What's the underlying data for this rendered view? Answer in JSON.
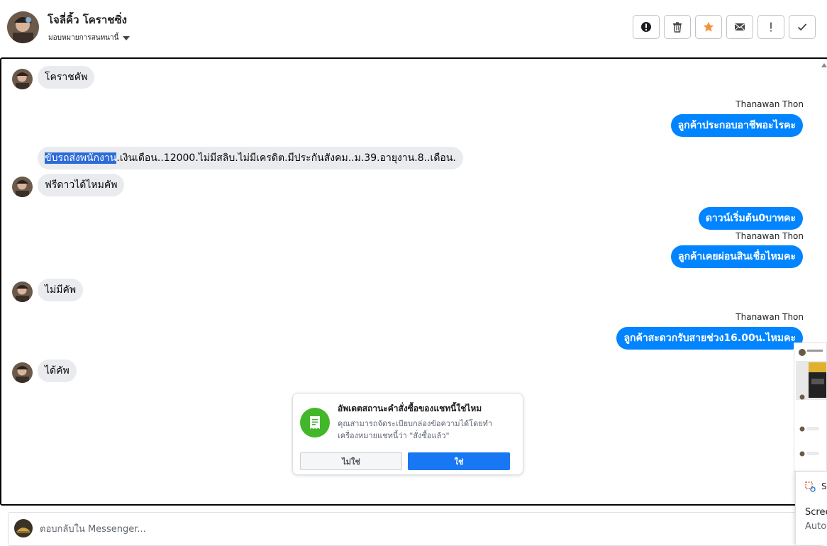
{
  "header": {
    "contact_name": "โจลี่คิ้ว โคราชซิ่ง",
    "assign_label": "มอบหมายการสนทนานี้",
    "actions": [
      {
        "name": "spam-button",
        "icon": "exclamation-circle-icon"
      },
      {
        "name": "delete-button",
        "icon": "trash-icon"
      },
      {
        "name": "star-button",
        "icon": "star-icon"
      },
      {
        "name": "mark-unread-button",
        "icon": "envelope-icon"
      },
      {
        "name": "follow-up-button",
        "icon": "exclamation-icon"
      },
      {
        "name": "done-button",
        "icon": "checkmark-icon"
      }
    ],
    "star_color": "#f7923b"
  },
  "messages": {
    "m1": "โคราชคัพ",
    "s1": "Thanawan Thon",
    "m2": "ลูกค้าประกอบอาชีพอะไรคะ",
    "m3_selected": "ขับรถส่งพนักงาน",
    "m3_rest": ".เงินเดือน..12000.ไม่มีสลิบ.ไม่มีเครดิต.มีประกันสังคม..ม.39.อายุงาน.8..เดือน.",
    "m4": "ฟรีดาวได้ไหมคัพ",
    "m5": "ดาวน์เริ่มต้น0บาทคะ",
    "s2": "Thanawan Thon",
    "m6": "ลูกค้าเคยผ่อนสินเชื่อไหมคะ",
    "m7": "ไม่มีคัพ",
    "s3": "Thanawan Thon",
    "m8": "ลูกค้าสะดวกรับสายช่วง16.00น.ไหมคะ",
    "m9": "ได้คัพ"
  },
  "prompt": {
    "title": "อัพเดตสถานะคำสั่งซื้อของแชทนี้ใช่ไหม",
    "body": "คุณสามารถจัดระเบียบกล่องข้อความได้โดยทำเครื่องหมายแชทนี้ว่า \"สั่งซื้อแล้ว\"",
    "no_label": "ไม่ใช่",
    "yes_label": "ใช่"
  },
  "reply": {
    "placeholder": "ตอบกลับใน Messenger..."
  },
  "overlay": {
    "panel_line1": "S",
    "panel_line2": "Scree",
    "panel_line3": "Auto"
  },
  "colors": {
    "outgoing_bubble": "#0084ff",
    "incoming_bubble": "#e9ebee",
    "primary_button": "#1877f2",
    "prompt_icon": "#42b72a",
    "selection": "#2c6bd8"
  }
}
